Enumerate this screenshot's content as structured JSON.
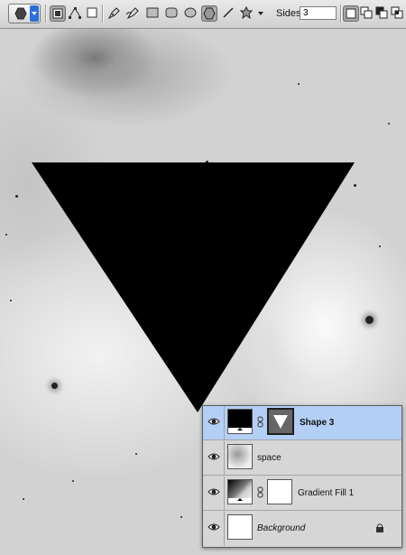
{
  "toolbar": {
    "sides_label": "Sides:",
    "sides_value": "3",
    "icons": [
      "polygon-preset",
      "shape-layers",
      "paths",
      "fill-pixels",
      "pen",
      "freeform-pen",
      "rectangle",
      "rounded-rectangle",
      "ellipse",
      "polygon",
      "line",
      "custom-shape",
      "dropdown-arrow",
      "new-shape-layer",
      "add-to-shape",
      "subtract-from-shape",
      "intersect-shape"
    ],
    "active_tool": "polygon"
  },
  "canvas": {
    "shape": "inverted-triangle",
    "shape_color": "#000000"
  },
  "layers": {
    "selected_color": "#b4cff6",
    "items": [
      {
        "name": "Shape 3",
        "style": "bold",
        "selected": true
      },
      {
        "name": "space",
        "style": "normal",
        "selected": false
      },
      {
        "name": "Gradient Fill 1",
        "style": "normal",
        "selected": false
      },
      {
        "name": "Background",
        "style": "italic",
        "selected": false,
        "locked": true
      }
    ]
  }
}
